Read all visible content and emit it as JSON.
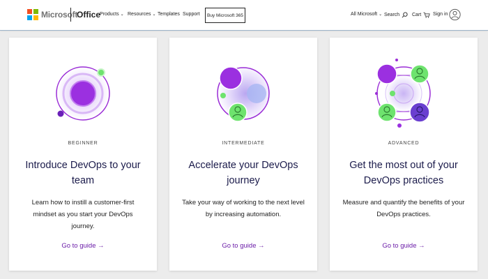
{
  "header": {
    "logo_text": "Microsoft",
    "brand": "Office",
    "nav": [
      {
        "label": "Products",
        "has_chevron": true
      },
      {
        "label": "Resources",
        "has_chevron": true
      },
      {
        "label": "Templates",
        "has_chevron": false
      },
      {
        "label": "Support",
        "has_chevron": false
      }
    ],
    "buy_button": "Buy Microsoft 365",
    "all_microsoft": "All Microsoft",
    "search": "Search",
    "cart": "Cart",
    "sign_in": "Sign in"
  },
  "cards": [
    {
      "level": "BEGINNER",
      "title": "Introduce DevOps to your team",
      "description": "Learn how to instill a customer-first mindset as you start your DevOps journey.",
      "link": "Go to guide →"
    },
    {
      "level": "INTERMEDIATE",
      "title": "Accelerate your DevOps journey",
      "description": "Take your way of working to the next level by increasing automation.",
      "link": "Go to guide →"
    },
    {
      "level": "ADVANCED",
      "title": "Get the most out of your DevOps practices",
      "description": "Measure and quantify the benefits of your DevOps practices.",
      "link": "Go to guide →"
    }
  ],
  "colors": {
    "accent_purple": "#8a1ed8",
    "link_purple": "#6b1ca8",
    "accent_green": "#6ee36e",
    "title_navy": "#1b1b4b"
  },
  "icons": [
    "chevron-down-icon",
    "search-icon",
    "cart-icon",
    "user-avatar-icon",
    "arrow-right-icon"
  ]
}
